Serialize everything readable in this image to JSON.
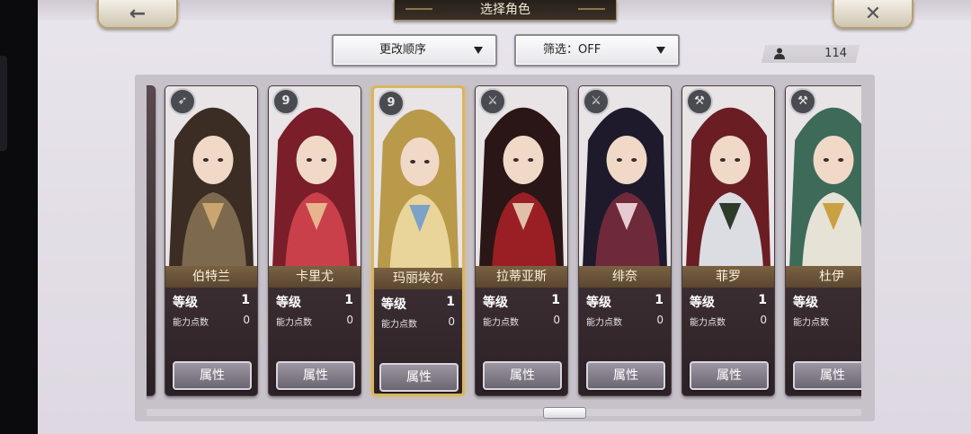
{
  "header": {
    "title": "选择角色",
    "back_icon": "←",
    "close_icon": "✕"
  },
  "controls": {
    "sort_label": "更改顺序",
    "filter_label": "筛选：OFF",
    "roster_count": "114"
  },
  "card_labels": {
    "level": "等级",
    "ability_points": "能力点数",
    "attributes_button": "属性"
  },
  "characters": [
    {
      "name": "伯特兰",
      "level": "1",
      "ability_points": "0",
      "class_icon": "staff-icon",
      "glyph": "➶",
      "selected": false,
      "palette": [
        "#3b2d24",
        "#7d6a4e",
        "#caa56e"
      ]
    },
    {
      "name": "卡里尤",
      "level": "1",
      "ability_points": "0",
      "class_icon": "fist-icon",
      "glyph": "9",
      "selected": false,
      "palette": [
        "#7a1e2a",
        "#c9404a",
        "#e8b48f"
      ]
    },
    {
      "name": "玛丽埃尔",
      "level": "1",
      "ability_points": "0",
      "class_icon": "fist-icon",
      "glyph": "9",
      "selected": true,
      "palette": [
        "#b89a4a",
        "#e9d59a",
        "#7da2c8"
      ]
    },
    {
      "name": "拉蒂亚斯",
      "level": "1",
      "ability_points": "0",
      "class_icon": "sword-icon",
      "glyph": "⚔",
      "selected": false,
      "palette": [
        "#2a1616",
        "#9a1f24",
        "#e0c0a8"
      ]
    },
    {
      "name": "绯奈",
      "level": "1",
      "ability_points": "0",
      "class_icon": "blade-icon",
      "glyph": "⚔",
      "selected": false,
      "palette": [
        "#1e1a2c",
        "#6e2a3a",
        "#e8cbd0"
      ]
    },
    {
      "name": "菲罗",
      "level": "1",
      "ability_points": "0",
      "class_icon": "hammer-icon",
      "glyph": "⚒",
      "selected": false,
      "palette": [
        "#6a1e24",
        "#dcdde3",
        "#2e3a2a"
      ]
    },
    {
      "name": "杜伊",
      "level": "1",
      "ability_points": "0",
      "class_icon": "hammer-icon",
      "glyph": "⚒",
      "selected": false,
      "palette": [
        "#3e6a5a",
        "#e7e2d6",
        "#c9a044"
      ]
    }
  ]
}
